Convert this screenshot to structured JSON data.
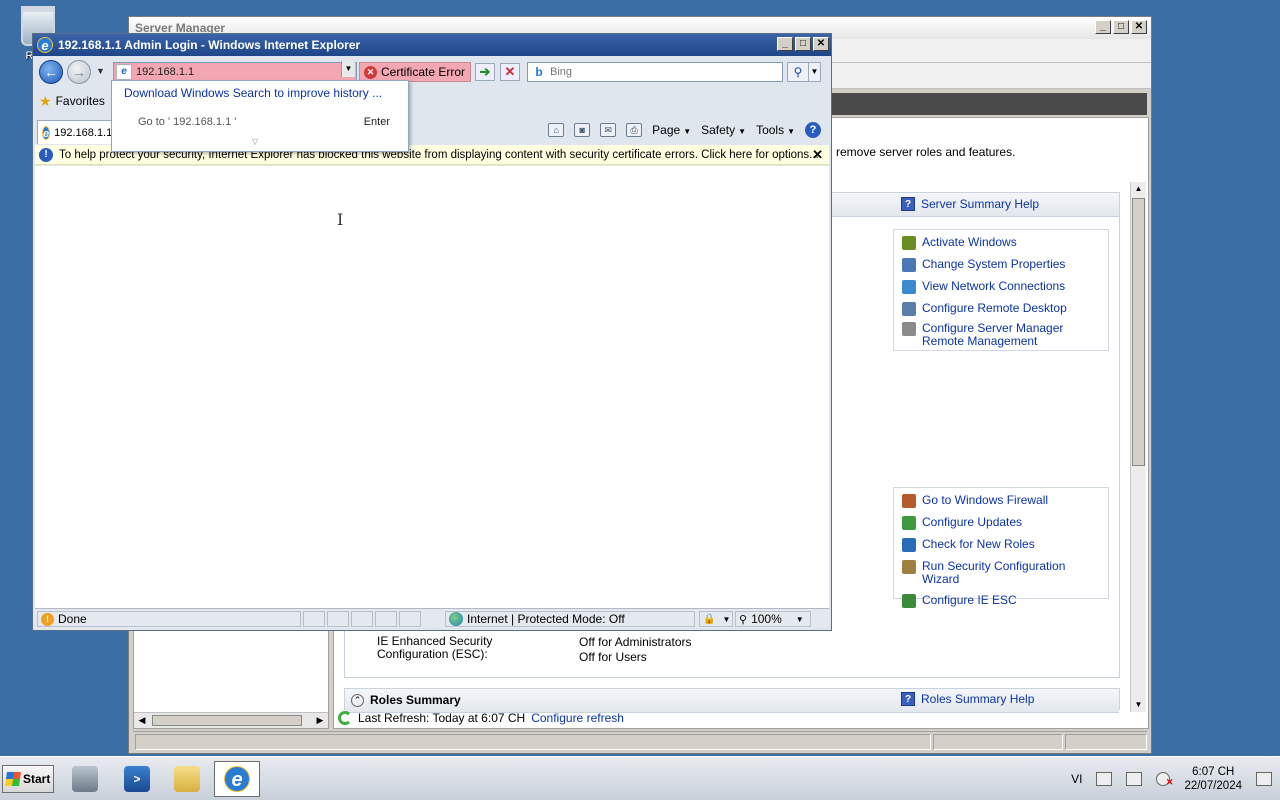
{
  "desktop": {
    "recycle_label": "Recy"
  },
  "server_manager": {
    "title": "Server Manager",
    "intro_text": "remove server roles and features.",
    "summary_help": "Server Summary Help",
    "tasks_a": [
      {
        "label": "Activate Windows",
        "icon": "activate-windows-icon",
        "color": "#6b8e23"
      },
      {
        "label": "Change System Properties",
        "icon": "system-properties-icon",
        "color": "#4a78b5"
      },
      {
        "label": "View Network Connections",
        "icon": "network-connections-icon",
        "color": "#3b8ad0"
      },
      {
        "label": "Configure Remote Desktop",
        "icon": "remote-desktop-icon",
        "color": "#5a7fa8"
      },
      {
        "label": "Configure Server Manager Remote Management",
        "icon": "server-remote-icon",
        "color": "#8a8a8a"
      }
    ],
    "tasks_b": [
      {
        "label": "Go to Windows Firewall",
        "icon": "firewall-icon",
        "color": "#b45a2a"
      },
      {
        "label": "Configure Updates",
        "icon": "updates-icon",
        "color": "#3f9a3f"
      },
      {
        "label": "Check for New Roles",
        "icon": "new-roles-icon",
        "color": "#2a6ab8"
      },
      {
        "label": "Run Security Configuration Wizard",
        "icon": "security-wizard-icon",
        "color": "#a08040"
      },
      {
        "label": "Configure IE ESC",
        "icon": "ie-esc-icon",
        "color": "#3a8a3a"
      }
    ],
    "ie_esc_label": "IE Enhanced Security Configuration (ESC):",
    "ie_esc_admins": "Off for Administrators",
    "ie_esc_users": "Off for Users",
    "roles_summary": "Roles Summary",
    "roles_help": "Roles Summary Help",
    "last_refresh": "Last Refresh: Today at 6:07 CH",
    "configure_refresh": "Configure refresh"
  },
  "ie": {
    "title": "192.168.1.1 Admin Login - Windows Internet Explorer",
    "address": "192.168.1.1",
    "cert_error": "Certificate Error",
    "search_placeholder": "Bing",
    "favorites": "Favorites",
    "tab_label": "192.168.1.1",
    "dropdown_download": "Download Windows Search to improve history ...",
    "dropdown_goto": "Go to ' 192.168.1.1 '",
    "dropdown_enter": "Enter",
    "cmd": {
      "page": "Page",
      "safety": "Safety",
      "tools": "Tools"
    },
    "infobar": "To help protect your security, Internet Explorer has blocked this website from displaying content with security certificate errors. Click here for options...",
    "status_done": "Done",
    "status_zone": "Internet | Protected Mode: Off",
    "zoom": "100%"
  },
  "taskbar": {
    "start": "Start",
    "lang": "VI",
    "time": "6:07 CH",
    "date": "22/07/2024"
  }
}
